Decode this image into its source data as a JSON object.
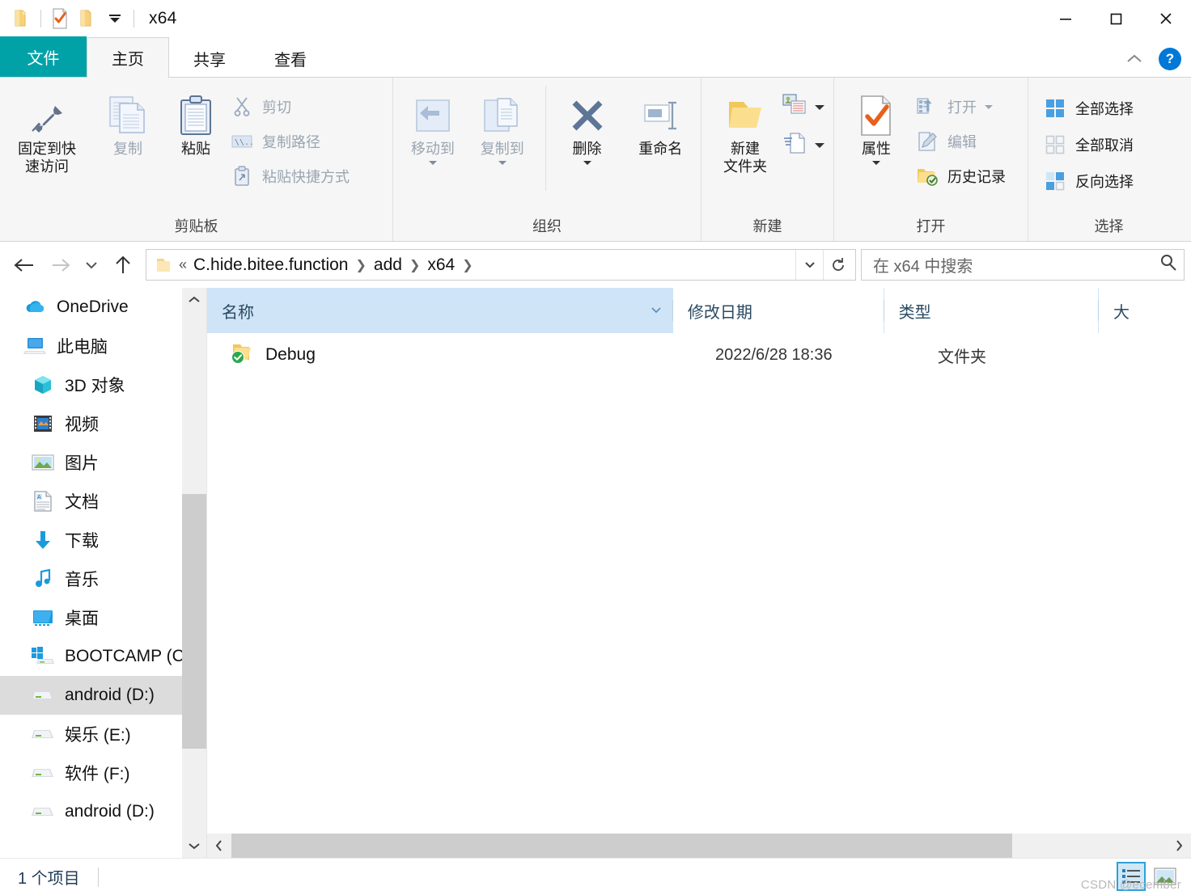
{
  "window": {
    "title": "x64",
    "quick_access": [
      {
        "name": "folder-icon",
        "label": "folder"
      },
      {
        "name": "properties-icon",
        "label": "properties"
      },
      {
        "name": "new-folder-icon",
        "label": "new folder"
      },
      {
        "name": "customize-qat-icon",
        "label": "customize"
      }
    ],
    "controls": {
      "minimize": "minimize",
      "maximize": "maximize",
      "close": "close"
    }
  },
  "tabs": [
    {
      "id": "file",
      "label": "文件"
    },
    {
      "id": "home",
      "label": "主页"
    },
    {
      "id": "share",
      "label": "共享"
    },
    {
      "id": "view",
      "label": "查看"
    }
  ],
  "tab_right": {
    "collapse_label": "collapse-ribbon",
    "help_label": "?"
  },
  "ribbon": {
    "groups": [
      {
        "id": "clipboard",
        "label": "剪贴板",
        "big": [
          {
            "id": "pin",
            "label": "固定到快\n速访问",
            "line1": "固定到快",
            "line2": "速访问",
            "icon": "pin-icon",
            "disabled": false
          },
          {
            "id": "copy",
            "label": "复制",
            "icon": "copy-icon",
            "disabled": true
          },
          {
            "id": "paste",
            "label": "粘贴",
            "icon": "paste-icon",
            "disabled": false
          }
        ],
        "small": [
          {
            "id": "cut",
            "label": "剪切",
            "icon": "scissors-icon",
            "disabled": true
          },
          {
            "id": "copy-path",
            "label": "复制路径",
            "icon": "copy-path-icon",
            "disabled": true
          },
          {
            "id": "paste-shortcut",
            "label": "粘贴快捷方式",
            "icon": "paste-shortcut-icon",
            "disabled": true
          }
        ]
      },
      {
        "id": "organize",
        "label": "组织",
        "big": [
          {
            "id": "move-to",
            "label": "移动到",
            "icon": "move-to-icon",
            "disabled": true,
            "dropdown": true
          },
          {
            "id": "copy-to",
            "label": "复制到",
            "icon": "copy-to-icon",
            "disabled": true,
            "dropdown": true
          },
          {
            "id": "delete",
            "label": "删除",
            "icon": "delete-icon",
            "disabled": false,
            "dropdown": true
          },
          {
            "id": "rename",
            "label": "重命名",
            "icon": "rename-icon",
            "disabled": false
          }
        ],
        "small": []
      },
      {
        "id": "new",
        "label": "新建",
        "big": [
          {
            "id": "new-folder",
            "label": "新建文件夹",
            "line1": "新建",
            "line2": "文件夹",
            "icon": "new-folder-big-icon",
            "disabled": false
          }
        ],
        "small": [
          {
            "id": "new-item",
            "label": "",
            "icon": "new-item-icon",
            "disabled": false,
            "dropdown": true
          },
          {
            "id": "easy-access",
            "label": "",
            "icon": "easy-access-icon",
            "disabled": false,
            "dropdown": true
          }
        ]
      },
      {
        "id": "open",
        "label": "打开",
        "big": [
          {
            "id": "properties",
            "label": "属性",
            "icon": "properties-big-icon",
            "disabled": false,
            "dropdown": true
          }
        ],
        "small": [
          {
            "id": "open",
            "label": "打开",
            "icon": "open-icon",
            "disabled": true,
            "dropdown": true
          },
          {
            "id": "edit",
            "label": "编辑",
            "icon": "edit-icon",
            "disabled": true
          },
          {
            "id": "history",
            "label": "历史记录",
            "icon": "history-icon",
            "disabled": false
          }
        ]
      },
      {
        "id": "select",
        "label": "选择",
        "big": [],
        "small": [
          {
            "id": "select-all",
            "label": "全部选择",
            "icon": "select-all-icon",
            "disabled": false
          },
          {
            "id": "select-none",
            "label": "全部取消",
            "icon": "select-none-icon",
            "disabled": false
          },
          {
            "id": "invert-selection",
            "label": "反向选择",
            "icon": "invert-selection-icon",
            "disabled": false
          }
        ]
      }
    ]
  },
  "address": {
    "back": "back-arrow",
    "forward": "forward-arrow",
    "recent": "recent-locations",
    "up": "up-arrow",
    "crumb_prefix": "«",
    "breadcrumbs": [
      "C.hide.bitee.function",
      "add",
      "x64"
    ],
    "dropdown": "address-dropdown",
    "refresh": "refresh-icon"
  },
  "search": {
    "placeholder": "在 x64 中搜索",
    "icon": "search-icon"
  },
  "sidebar": {
    "items": [
      {
        "id": "onedrive",
        "label": "OneDrive",
        "icon": "onedrive-icon",
        "level": 0,
        "selected": false
      },
      {
        "id": "this-pc",
        "label": "此电脑",
        "icon": "this-pc-icon",
        "level": 0,
        "selected": false
      },
      {
        "id": "3d-objects",
        "label": "3D 对象",
        "icon": "3d-objects-icon",
        "level": 1,
        "selected": false
      },
      {
        "id": "videos",
        "label": "视频",
        "icon": "videos-icon",
        "level": 1,
        "selected": false
      },
      {
        "id": "pictures",
        "label": "图片",
        "icon": "pictures-icon",
        "level": 1,
        "selected": false
      },
      {
        "id": "documents",
        "label": "文档",
        "icon": "documents-icon",
        "level": 1,
        "selected": false
      },
      {
        "id": "downloads",
        "label": "下载",
        "icon": "downloads-icon",
        "level": 1,
        "selected": false
      },
      {
        "id": "music",
        "label": "音乐",
        "icon": "music-icon",
        "level": 1,
        "selected": false
      },
      {
        "id": "desktop",
        "label": "桌面",
        "icon": "desktop-icon",
        "level": 1,
        "selected": false
      },
      {
        "id": "bootcamp",
        "label": "BOOTCAMP (C",
        "icon": "windows-drive-icon",
        "level": 1,
        "selected": false
      },
      {
        "id": "android-d",
        "label": "android (D:)",
        "icon": "drive-icon",
        "level": 1,
        "selected": true
      },
      {
        "id": "entertainment-e",
        "label": "娱乐 (E:)",
        "icon": "drive-icon",
        "level": 1,
        "selected": false
      },
      {
        "id": "software-f",
        "label": "软件 (F:)",
        "icon": "drive-icon",
        "level": 1,
        "selected": false
      },
      {
        "id": "android-d-2",
        "label": "android (D:)",
        "icon": "drive-icon",
        "level": 1,
        "selected": false
      }
    ]
  },
  "file_list": {
    "columns": [
      {
        "id": "name",
        "label": "名称",
        "sorted": true,
        "sort_dir": "asc"
      },
      {
        "id": "date_modified",
        "label": "修改日期",
        "sorted": false
      },
      {
        "id": "type",
        "label": "类型",
        "sorted": false
      },
      {
        "id": "size",
        "label": "大",
        "sorted": false
      }
    ],
    "rows": [
      {
        "name": "Debug",
        "date_modified": "2022/6/28 18:36",
        "type": "文件夹",
        "size": "",
        "icon": "folder-synced-icon"
      }
    ]
  },
  "status": {
    "item_count": "1 个项目",
    "view_buttons": [
      {
        "id": "details-view",
        "label": "details-view-icon",
        "active": true
      },
      {
        "id": "large-icons-view",
        "label": "large-icons-view-icon",
        "active": false
      }
    ]
  },
  "watermark": "CSDN @ecember",
  "colors": {
    "file_tab": "#00a2a8",
    "help_badge": "#0078d7",
    "column_header": "#cfe4f7",
    "selection": "#dcdcdc",
    "scroll_thumb": "#cdcdcd"
  }
}
